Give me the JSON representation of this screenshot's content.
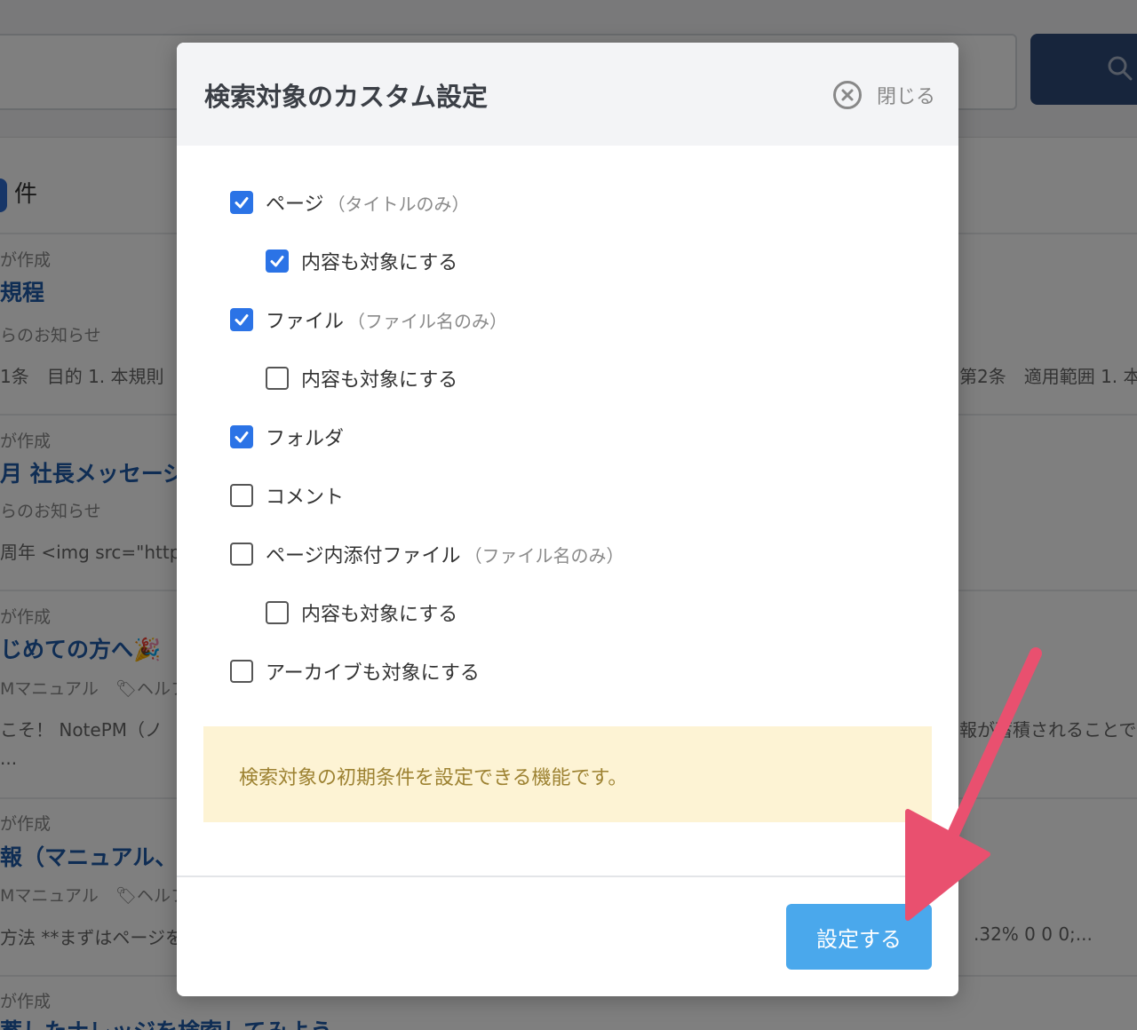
{
  "background": {
    "result_count_suffix": "件",
    "results": [
      {
        "meta": "が作成",
        "title": "規程",
        "sub": "らのお知らせ",
        "body_left": "1条　目的 1. 本規則",
        "body_right": "第2条　適用範囲 1. 本"
      },
      {
        "meta": "が作成",
        "title": "月 社長メッセージ",
        "sub": "らのお知らせ",
        "body_left": "周年 <img src=\"https",
        "body_right": ""
      },
      {
        "meta": "が作成",
        "title": "じめての方へ🎉",
        "sub": "Mマニュアル　🏷ヘルフ",
        "body_left": "こそ！ NotePM（ノ",
        "body_right": "報が蓄積されることで",
        "body_extra": "..."
      },
      {
        "meta": "が作成",
        "title": "報（マニュアル、",
        "sub": "Mマニュアル　🏷ヘルフ",
        "body_left": "方法 **まずはページを",
        "body_right": ".32% 0 0 0;..."
      },
      {
        "meta": "が作成",
        "title": "蓄したナレッジを検索してみよう",
        "sub": "",
        "body_left": "",
        "body_right": ""
      }
    ]
  },
  "modal": {
    "title": "検索対象のカスタム設定",
    "close_label": "閉じる",
    "options": [
      {
        "label": "ページ",
        "note": "（タイトルのみ）",
        "checked": true
      },
      {
        "label": "内容も対象にする",
        "note": "",
        "checked": true
      },
      {
        "label": "ファイル",
        "note": "（ファイル名のみ）",
        "checked": true
      },
      {
        "label": "内容も対象にする",
        "note": "",
        "checked": false
      },
      {
        "label": "フォルダ",
        "note": "",
        "checked": true
      },
      {
        "label": "コメント",
        "note": "",
        "checked": false
      },
      {
        "label": "ページ内添付ファイル",
        "note": "（ファイル名のみ）",
        "checked": false
      },
      {
        "label": "内容も対象にする",
        "note": "",
        "checked": false
      },
      {
        "label": "アーカイブも対象にする",
        "note": "",
        "checked": false
      }
    ],
    "info_text": "検索対象の初期条件を設定できる機能です。",
    "submit_label": "設定する"
  },
  "colors": {
    "checkbox_checked": "#2b73e6",
    "submit_button": "#4aa8ec",
    "info_background": "#fdf3d4",
    "info_text": "#9d8232",
    "annotation_arrow": "#e9506f"
  }
}
